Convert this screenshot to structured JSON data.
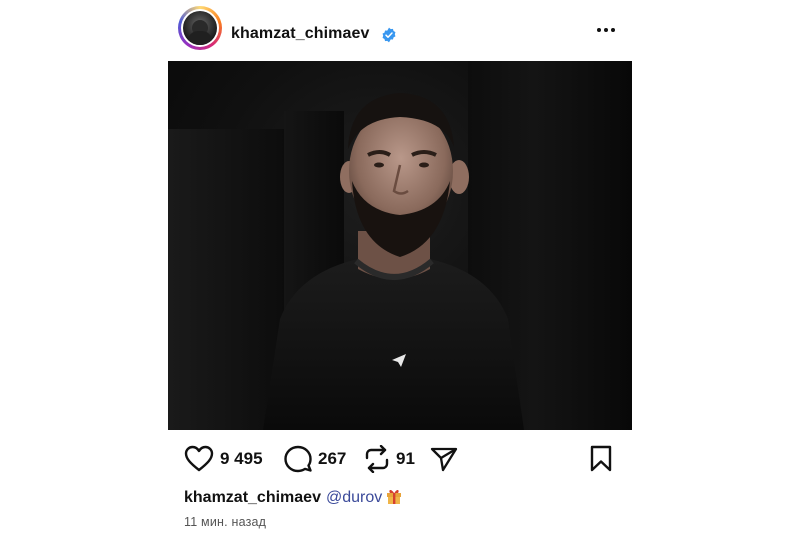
{
  "post": {
    "author": {
      "username": "khamzat_chimaev",
      "verified": true,
      "avatar_icon": "profile-avatar-icon",
      "story_ring_colors": [
        "#feda75",
        "#fa7e1e",
        "#d62976",
        "#962fbf",
        "#4f5bd5"
      ]
    },
    "menu_icon": "more-options-icon",
    "image_icon": "post-photo",
    "actions": {
      "likes": "9 495",
      "comments": "267",
      "reposts": "91",
      "like_icon": "heart-icon",
      "comment_icon": "comment-bubble-icon",
      "repost_icon": "repost-icon",
      "share_icon": "send-icon",
      "save_icon": "bookmark-icon"
    },
    "caption": {
      "username": "khamzat_chimaev",
      "mention": "@durov",
      "emoji": "🎁",
      "emoji_icon": "gift-icon"
    },
    "timestamp": "11 мин. назад"
  },
  "colors": {
    "verified_badge": "#3897f0",
    "mention": "#3b4a9a",
    "timestamp": "#555555"
  }
}
